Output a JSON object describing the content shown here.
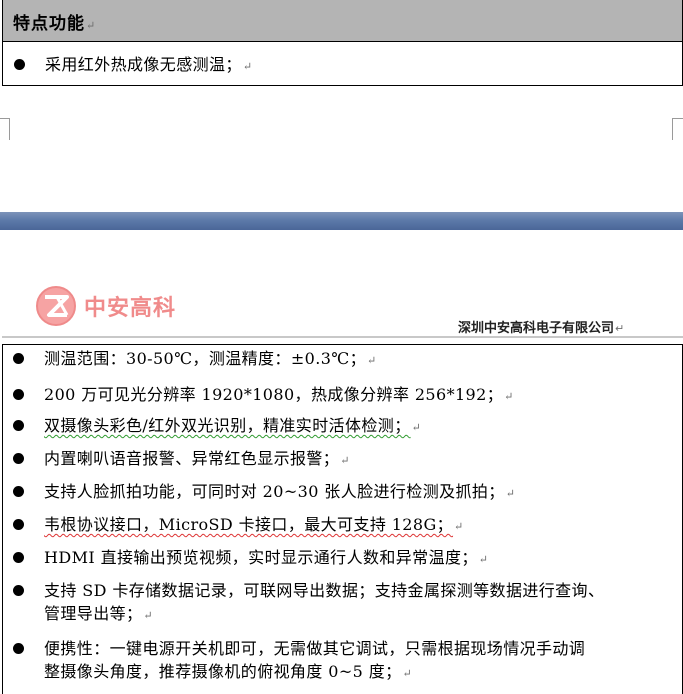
{
  "section1": {
    "heading": "特点功能",
    "items": [
      "采用红外热成像无感测温；"
    ]
  },
  "logo": {
    "text": "中安高科"
  },
  "header": {
    "company": "深圳中安高科电子有限公司"
  },
  "features": [
    "测温范围：30-50℃，测温精度：±0.3℃；",
    "200 万可见光分辨率 1920*1080，热成像分辨率 256*192；",
    "双摄像头彩色/红外双光识别，精准实时活体检测；",
    "内置喇叭语音报警、异常红色显示报警；",
    "支持人脸抓拍功能，可同时对 20~30 张人脸进行检测及抓拍；",
    "韦根协议接口，MicroSD 卡接口，最大可支持 128G；",
    "HDMI 直接输出预览视频，实时显示通行人数和异常温度；",
    "支持 SD 卡存储数据记录，可联网导出数据；支持金属探测等数据进行查询、",
    "管理导出等；",
    "便携性：一键电源开关机即可，无需做其它调试，只需根据现场情况手动调",
    "整摄像头角度，推荐摄像机的俯视角度 0~5 度；"
  ],
  "marks": {
    "paragraph": "↵",
    "cell": "↵"
  },
  "colors": {
    "heading_bg": "#b4b4b4",
    "band": "#5d7aa9",
    "logo": "#f08b8b"
  }
}
